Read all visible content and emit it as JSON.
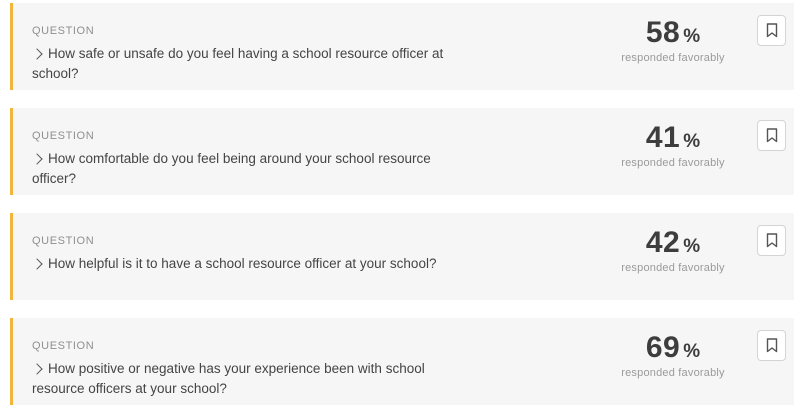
{
  "questions": [
    {
      "eyebrow": "QUESTION",
      "text": "How safe or unsafe do you feel having a school resource officer at school?",
      "percent": "58",
      "percent_sign": "%",
      "caption": "responded favorably"
    },
    {
      "eyebrow": "QUESTION",
      "text": "How comfortable do you feel being around your school resource officer?",
      "percent": "41",
      "percent_sign": "%",
      "caption": "responded favorably"
    },
    {
      "eyebrow": "QUESTION",
      "text": "How helpful is it to have a school resource officer at your school?",
      "percent": "42",
      "percent_sign": "%",
      "caption": "responded favorably"
    },
    {
      "eyebrow": "QUESTION",
      "text": "How positive or negative has your experience been with school resource officers at your school?",
      "percent": "69",
      "percent_sign": "%",
      "caption": "responded favorably"
    }
  ],
  "colors": {
    "accent": "#f2b63c",
    "card_bg": "#f6f6f6"
  },
  "icons": {
    "expand": "chevron-right-icon",
    "save": "bookmark-icon"
  }
}
